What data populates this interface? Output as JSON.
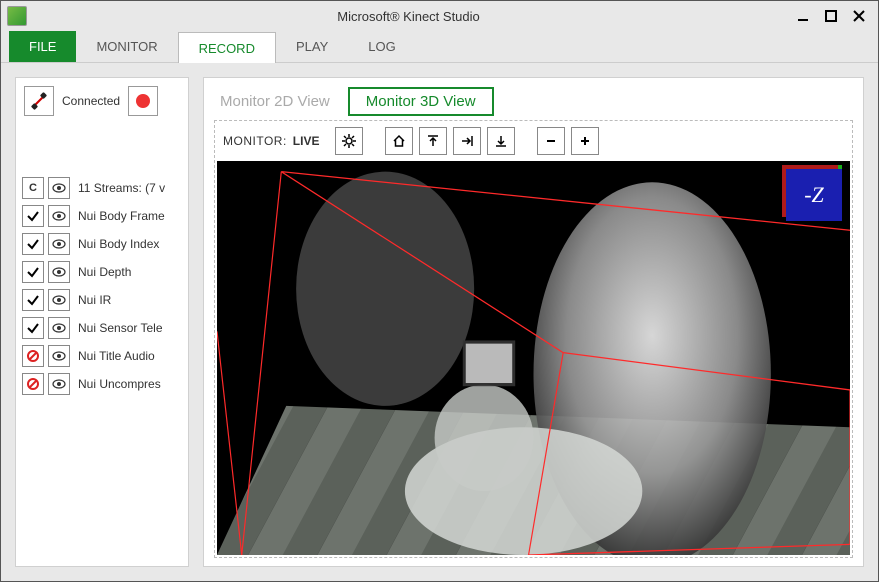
{
  "title": "Microsoft® Kinect Studio",
  "menus": {
    "file": "FILE",
    "monitor": "MONITOR",
    "record": "RECORD",
    "play": "PLAY",
    "log": "LOG"
  },
  "connection": {
    "label": "Connected"
  },
  "streams": {
    "header": "11 Streams: (7 v",
    "header_c": "C",
    "items": [
      {
        "label": "Nui Body Frame",
        "enabled": true
      },
      {
        "label": "Nui Body Index",
        "enabled": true
      },
      {
        "label": "Nui Depth",
        "enabled": true
      },
      {
        "label": "Nui IR",
        "enabled": true
      },
      {
        "label": "Nui Sensor Tele",
        "enabled": true
      },
      {
        "label": "Nui Title Audio",
        "enabled": false
      },
      {
        "label": "Nui Uncompres",
        "enabled": false
      }
    ]
  },
  "view_tabs": {
    "inactive": "Monitor 2D View",
    "active": "Monitor 3D View"
  },
  "monitor_bar": {
    "label": "MONITOR:",
    "value": "LIVE"
  },
  "axis_label": "-Z"
}
